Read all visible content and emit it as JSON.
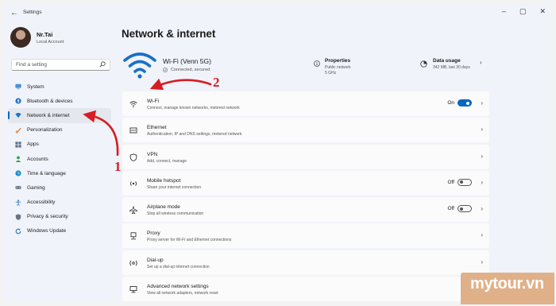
{
  "window": {
    "title": "Settings",
    "back_icon": "arrow-left-icon",
    "controls": [
      "minimize-icon",
      "maximize-icon",
      "close-icon"
    ]
  },
  "profile": {
    "name": "Nr.Tai",
    "account_type": "Local Account"
  },
  "search": {
    "placeholder": "Find a setting"
  },
  "sidebar": {
    "items": [
      {
        "label": "System",
        "icon": "monitor-icon",
        "color": "#4a8fd6",
        "active": false
      },
      {
        "label": "Bluetooth & devices",
        "icon": "bluetooth-icon",
        "color": "#1f6fc5",
        "active": false
      },
      {
        "label": "Network & internet",
        "icon": "network-icon",
        "color": "#1a73c9",
        "active": true
      },
      {
        "label": "Personalization",
        "icon": "brush-icon",
        "color": "#d26a3c",
        "active": false
      },
      {
        "label": "Apps",
        "icon": "apps-icon",
        "color": "#5c6f86",
        "active": false
      },
      {
        "label": "Accounts",
        "icon": "person-icon",
        "color": "#2fa34d",
        "active": false
      },
      {
        "label": "Time & language",
        "icon": "globe-clock-icon",
        "color": "#1f8fd0",
        "active": false
      },
      {
        "label": "Gaming",
        "icon": "gamepad-icon",
        "color": "#6b7480",
        "active": false
      },
      {
        "label": "Accessibility",
        "icon": "accessibility-icon",
        "color": "#2f7fd6",
        "active": false
      },
      {
        "label": "Privacy & security",
        "icon": "shield-icon",
        "color": "#6b7480",
        "active": false
      },
      {
        "label": "Windows Update",
        "icon": "update-icon",
        "color": "#1a73c9",
        "active": false
      }
    ]
  },
  "page": {
    "title": "Network & internet"
  },
  "connection": {
    "name": "Wi-Fi (Venn 5G)",
    "status": "Connected, secured",
    "properties_title": "Properties",
    "properties_line1": "Public network",
    "properties_line2": "5 GHz",
    "usage_title": "Data usage",
    "usage_sub": "342 MB, last 30 days"
  },
  "rows": [
    {
      "title": "Wi-Fi",
      "subtitle": "Connect, manage known networks, metered network",
      "icon": "wifi-icon",
      "toggle": "On"
    },
    {
      "title": "Ethernet",
      "subtitle": "Authentication, IP and DNS settings, metered network",
      "icon": "ethernet-icon"
    },
    {
      "title": "VPN",
      "subtitle": "Add, connect, manage",
      "icon": "vpn-shield-icon"
    },
    {
      "title": "Mobile hotspot",
      "subtitle": "Share your internet connection",
      "icon": "hotspot-icon",
      "toggle": "Off"
    },
    {
      "title": "Airplane mode",
      "subtitle": "Stop all wireless communication",
      "icon": "airplane-icon",
      "toggle": "Off"
    },
    {
      "title": "Proxy",
      "subtitle": "Proxy server for Wi-Fi and Ethernet connections",
      "icon": "proxy-icon"
    },
    {
      "title": "Dial-up",
      "subtitle": "Set up a dial-up internet connection",
      "icon": "dialup-icon"
    },
    {
      "title": "Advanced network settings",
      "subtitle": "View all network adapters, network reset",
      "icon": "advanced-network-icon"
    }
  ],
  "annotations": {
    "step1": "1",
    "step2": "2",
    "color": "#d81c23"
  },
  "watermark": {
    "text": "mytour.vn",
    "color": "#e0b089"
  }
}
